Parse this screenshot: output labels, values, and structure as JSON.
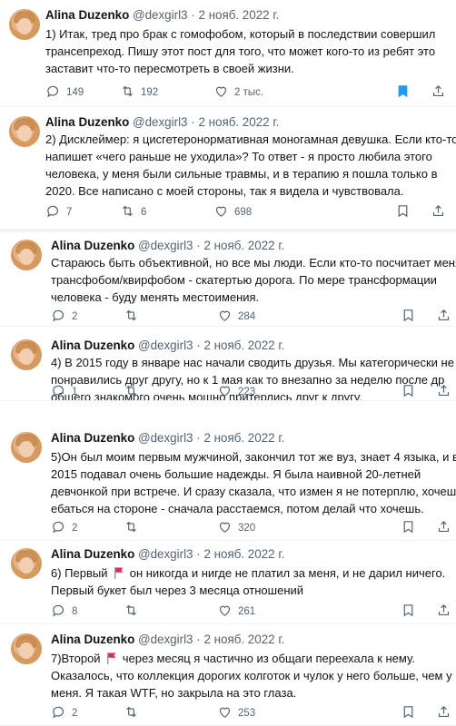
{
  "author": {
    "name": "Alina Duzenko",
    "handle": "@dexgirl3",
    "separator": "·",
    "date": "2 нояб. 2022 г."
  },
  "tweets": [
    {
      "lines": [
        "1) Итак, тред про брак с гомофобом, который в последствии совершил",
        "трансепреход. Пишу этот пост для того, что может кого-то из ребят это",
        "заставит что-то пересмотреть в своей жизни."
      ],
      "replies": "149",
      "retweets": "192",
      "likes": "2 тыс.",
      "bookmarked": true
    },
    {
      "lines": [
        "2) Дисклеймер: я цисгетеронормативная моногамная девушка. Если кто-то",
        "напишет «чего раньше не уходила»? То ответ - я просто любила этого",
        "человека, у меня были сильные травмы, и в терапию я пошла только в",
        "2020. Все написано с моей стороны, так я видела и чувствовала."
      ],
      "replies": "7",
      "retweets": "6",
      "likes": "698",
      "bookmarked": false
    },
    {
      "lines": [
        "Стараюсь быть объективной, но все мы люди. Если кто-то посчитает меня",
        "трансфобом/квирфобом - скатертью дорога. По мере трансформации",
        "человека - буду менять местоимения."
      ],
      "replies": "2",
      "retweets": "",
      "likes": "284",
      "bookmarked": false
    },
    {
      "lines": [
        "4) В 2015 году в январе нас начали сводить друзья. Мы категорически не",
        "понравились друг другу, но к 1 мая как то внезапно за неделю после др",
        "общего знакомого очень мощно притерлись друг к другу."
      ],
      "replies": "1",
      "retweets": "",
      "likes": "223",
      "bookmarked": false
    },
    {
      "lines": [
        "5)Он был моим первым мужчиной, закончил тот же вуз, знает 4 языка, и в",
        "2015 подавал очень большие надежды. Я была наивной 20-летней",
        "девчонкой при встрече. И сразу сказала, что измен я не потерплю, хочешь",
        "ебаться на стороне - сначала расстаемся, потом делай что хочешь."
      ],
      "replies": "2",
      "retweets": "",
      "likes": "320",
      "bookmarked": false
    },
    {
      "lines": [
        "6) Первый {flag} он никогда и нигде не платил за меня, и не дарил ничего.",
        "Первый букет был через 3 месяца отношений"
      ],
      "replies": "8",
      "retweets": "",
      "likes": "261",
      "bookmarked": false
    },
    {
      "lines": [
        "7)Второй {flag} через месяц я частично из общаги переехала к нему.",
        "Оказалось, что коллекция дорогих колготок и чулок у него больше, чем у",
        "меня. Я такая WTF, но закрыла на это глаза."
      ],
      "replies": "2",
      "retweets": "",
      "likes": "253",
      "bookmarked": false
    }
  ],
  "icons": {
    "reply": "reply-icon",
    "retweet": "retweet-icon",
    "like": "heart-icon",
    "bookmark": "bookmark-icon",
    "share": "share-icon",
    "flag": "red-flag-icon"
  },
  "colors": {
    "bookmark_active": "#1d9bf0",
    "muted": "#536471",
    "flag": "#e0245e"
  }
}
